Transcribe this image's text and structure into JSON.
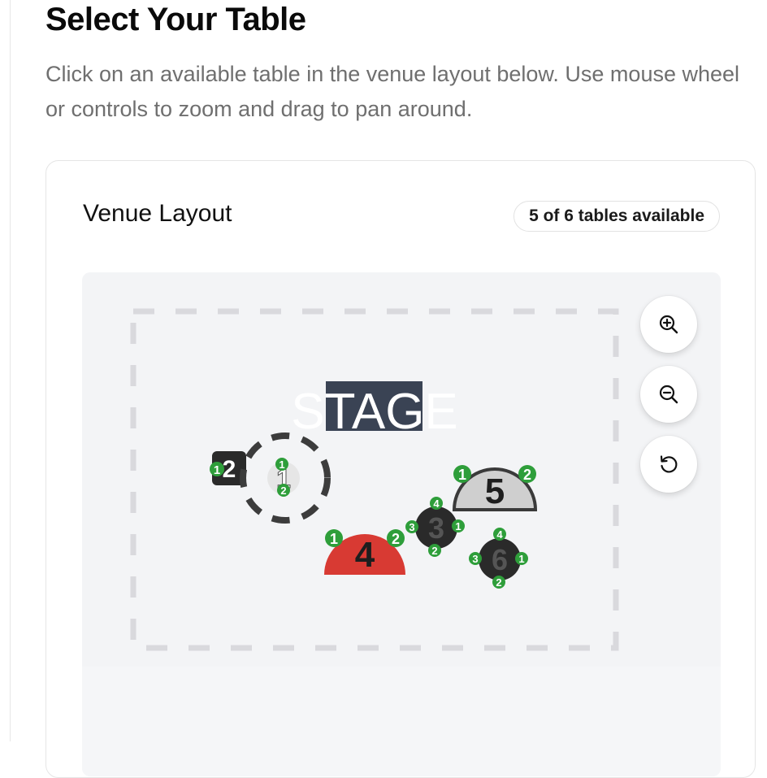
{
  "page": {
    "title": "Select Your Table",
    "instructions": "Click on an available table in the venue layout below. Use mouse wheel or controls to zoom and drag to pan around."
  },
  "venue": {
    "title": "Venue Layout",
    "availability": "5 of 6 tables available",
    "stage_label": "STAGE",
    "controls": {
      "zoom_in": "zoom-in-icon",
      "zoom_out": "zoom-out-icon",
      "reset": "reset-icon"
    },
    "tables": [
      {
        "number": "1",
        "shape": "round",
        "status": "selected",
        "seats": [
          "1",
          "2"
        ]
      },
      {
        "number": "2",
        "shape": "square",
        "status": "available",
        "seats": [
          "1"
        ]
      },
      {
        "number": "3",
        "shape": "round",
        "status": "available",
        "seats": [
          "1",
          "2",
          "3",
          "4"
        ]
      },
      {
        "number": "4",
        "shape": "half-round",
        "status": "unavailable",
        "seats": [
          "1",
          "2"
        ]
      },
      {
        "number": "5",
        "shape": "half-round",
        "status": "available",
        "seats": [
          "1",
          "2"
        ]
      },
      {
        "number": "6",
        "shape": "round",
        "status": "available",
        "seats": [
          "1",
          "2",
          "3",
          "4"
        ]
      }
    ],
    "colors": {
      "seat": "#2e9e3a",
      "table_dark": "#2a2a2a",
      "table_light": "#cfcfcf",
      "table_unavailable": "#d83a33",
      "stage_highlight": "#3a4354",
      "boundary": "#d9d9dd"
    }
  }
}
